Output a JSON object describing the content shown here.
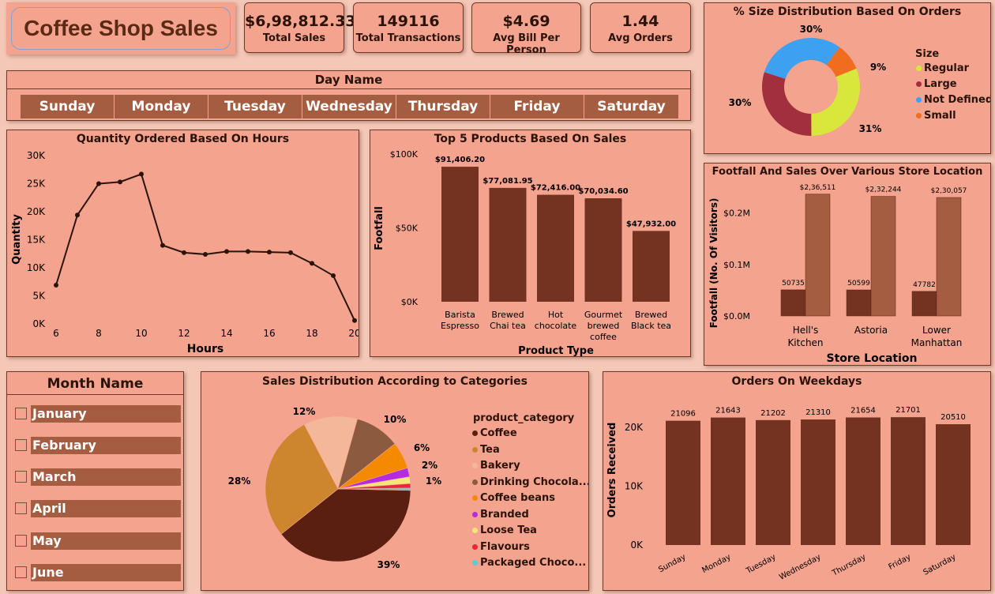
{
  "title": "Coffee Shop Sales",
  "kpis": [
    {
      "value": "$6,98,812.33",
      "label": "Total Sales"
    },
    {
      "value": "149116",
      "label": "Total Transactions"
    },
    {
      "value": "$4.69",
      "label": "Avg Bill Per Person"
    },
    {
      "value": "1.44",
      "label": "Avg Orders"
    }
  ],
  "day_slicer": {
    "title": "Day Name",
    "days": [
      "Sunday",
      "Monday",
      "Tuesday",
      "Wednesday",
      "Thursday",
      "Friday",
      "Saturday"
    ]
  },
  "month_slicer": {
    "title": "Month Name",
    "months": [
      "January",
      "February",
      "March",
      "April",
      "May",
      "June"
    ]
  },
  "colors": {
    "dark_brown": "#733320",
    "mid_brown": "#a45d40",
    "panel": "#f4a38f"
  },
  "chart_data": [
    {
      "id": "hours",
      "type": "line",
      "title": "Quantity Ordered Based On Hours",
      "xlabel": "Hours",
      "ylabel": "Quantity",
      "x": [
        6,
        7,
        8,
        9,
        10,
        11,
        12,
        13,
        14,
        15,
        16,
        17,
        18,
        19,
        20
      ],
      "values": [
        6900,
        19400,
        25000,
        25300,
        26700,
        14000,
        12700,
        12400,
        12900,
        12900,
        12800,
        12700,
        10800,
        8600,
        600
      ],
      "xticks": [
        6,
        8,
        10,
        12,
        14,
        16,
        18,
        20
      ],
      "yticks": [
        0,
        5000,
        10000,
        15000,
        20000,
        25000,
        30000
      ],
      "ytick_labels": [
        "0K",
        "5K",
        "10K",
        "15K",
        "20K",
        "25K",
        "30K"
      ],
      "ylim": [
        0,
        30000
      ],
      "xlim": [
        6,
        20
      ]
    },
    {
      "id": "products",
      "type": "bar",
      "title": "Top 5 Products Based On Sales",
      "xlabel": "Product Type",
      "ylabel": "Footfall",
      "categories": [
        [
          "Barista",
          "Espresso"
        ],
        [
          "Brewed",
          "Chai tea"
        ],
        [
          "Hot",
          "chocolate"
        ],
        [
          "Gourmet",
          "brewed",
          "coffee"
        ],
        [
          "Brewed",
          "Black tea"
        ]
      ],
      "values": [
        91406.2,
        77081.95,
        72416.0,
        70034.6,
        47932.0
      ],
      "value_labels": [
        "$91,406.20",
        "$77,081.95",
        "$72,416.00",
        "$70,034.60",
        "$47,932.00"
      ],
      "yticks": [
        0,
        50000,
        100000
      ],
      "ytick_labels": [
        "$0K",
        "$50K",
        "$100K"
      ],
      "ylim": [
        0,
        100000
      ]
    },
    {
      "id": "size",
      "type": "pie",
      "title": "% Size Distribution Based On Orders",
      "legend_title": "Size",
      "labels": [
        "Regular",
        "Large",
        "Not Defined",
        "Small"
      ],
      "values": [
        31,
        30,
        30,
        9
      ],
      "value_labels": [
        "31%",
        "30%",
        "30%",
        "9%"
      ],
      "colors": [
        "#d9e63b",
        "#a22f3e",
        "#3ea0f0",
        "#f06c1e"
      ]
    },
    {
      "id": "stores",
      "type": "bar",
      "title": "Footfall And Sales Over Various Store Location",
      "xlabel": "Store Location",
      "ylabel": "Footfall (No. Of Visitors)",
      "categories": [
        [
          "Hell's",
          "Kitchen"
        ],
        [
          "Astoria"
        ],
        [
          "Lower",
          "Manhattan"
        ]
      ],
      "series": [
        {
          "values": [
            50735,
            50599,
            47782
          ],
          "value_labels": [
            "50735",
            "50599",
            "47782"
          ],
          "color": "#733320"
        },
        {
          "values": [
            236511,
            232244,
            230057
          ],
          "value_labels": [
            "$2,36,511",
            "$2,32,244",
            "$2,30,057"
          ],
          "color": "#a45d40"
        }
      ],
      "yticks": [
        0,
        100000,
        200000
      ],
      "ytick_labels": [
        "$0.0M",
        "$0.1M",
        "$0.2M"
      ],
      "ylim": [
        0,
        250000
      ]
    },
    {
      "id": "categories",
      "type": "pie",
      "title": "Sales Distribution According to Categories",
      "legend_title": "product_category",
      "labels": [
        "Coffee",
        "Tea",
        "Bakery",
        "Drinking Chocola...",
        "Coffee beans",
        "Branded",
        "Loose Tea",
        "Flavours",
        "Packaged Choco..."
      ],
      "values": [
        39,
        28,
        12,
        10,
        6,
        2,
        1.5,
        1,
        0.5
      ],
      "value_labels": [
        "39%",
        "28%",
        "12%",
        "10%",
        "6%",
        "2%",
        "",
        "1%",
        ""
      ],
      "colors": [
        "#5a1f10",
        "#cd852e",
        "#f5b79a",
        "#8c5a3e",
        "#f58a00",
        "#b52ce0",
        "#f5e67a",
        "#e8283a",
        "#63c8d8"
      ]
    },
    {
      "id": "weekdays",
      "type": "bar",
      "title": "Orders On Weekdays",
      "ylabel": "Orders Received",
      "categories": [
        "Sunday",
        "Monday",
        "Tuesday",
        "Wednesday",
        "Thursday",
        "Friday",
        "Saturday"
      ],
      "values": [
        21096,
        21643,
        21202,
        21310,
        21654,
        21701,
        20510
      ],
      "value_labels": [
        "21096",
        "21643",
        "21202",
        "21310",
        "21654",
        "21701",
        "20510"
      ],
      "yticks": [
        0,
        10000,
        20000
      ],
      "ytick_labels": [
        "0K",
        "10K",
        "20K"
      ],
      "ylim": [
        0,
        24000
      ]
    }
  ]
}
